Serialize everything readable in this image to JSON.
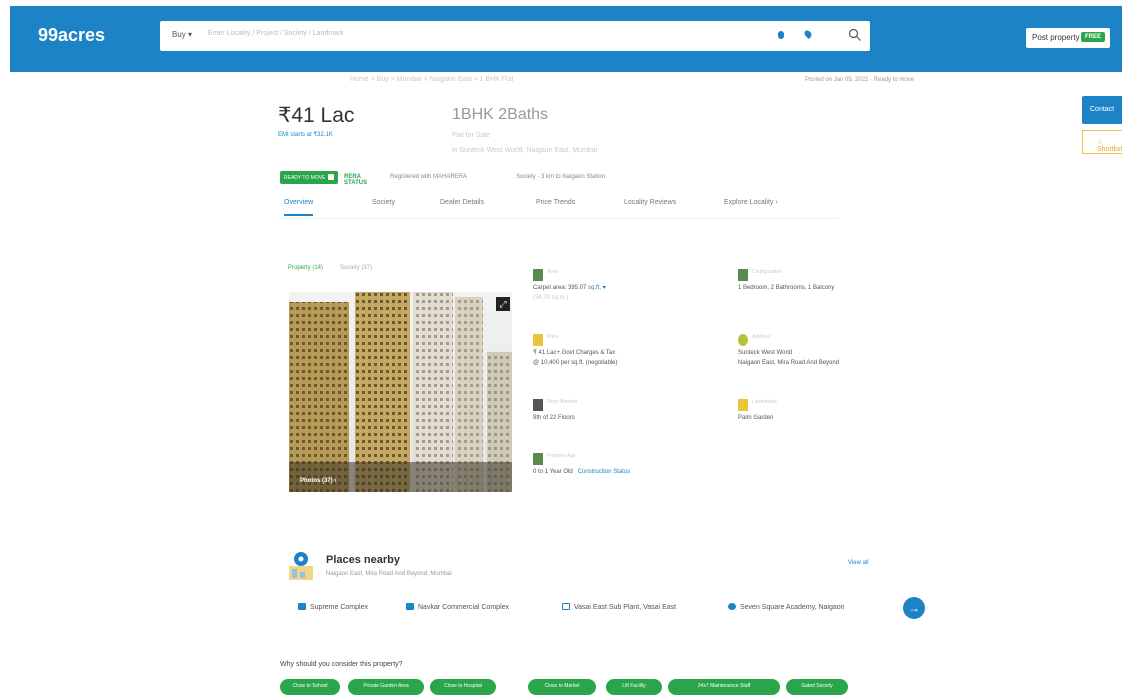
{
  "header": {
    "logo": "99acres",
    "search": {
      "buy_label": "Buy",
      "placeholder": "Enter Locality / Project / Society / Landmark"
    },
    "post_property": {
      "label": "Post property",
      "badge": "FREE"
    }
  },
  "breadcrumbs": "Home > Buy > Mumbai > Naigaon East > 1 BHK Flat",
  "posted": "Posted on Jan 05, 2022 · Ready to move",
  "listing": {
    "price": "₹41 Lac",
    "emi": "EMI starts at ₹32.1K",
    "config": "1BHK 2Baths",
    "subtitle": "Flat for Sale",
    "address": "in Sunteck West World, Naigaon East, Mumbai"
  },
  "actions": {
    "contact": "Contact",
    "shortlist": "☆ Shortlist"
  },
  "badges": {
    "status": "READY TO MOVE",
    "rera": "RERA STATUS",
    "approved": "Registered with MAHARERA",
    "society": "Society · 3 km to Naigaon Station"
  },
  "tabs": [
    "Overview",
    "Society",
    "Dealer Details",
    "Price Trends",
    "Locality Reviews",
    "Explore Locality"
  ],
  "photo_tabs": [
    "Property (14)",
    "Society (37)"
  ],
  "photo": {
    "count_label": "Photos (37) ›"
  },
  "facts": [
    {
      "icon": "area-icon",
      "label": "Area",
      "value": "Carpet area: 395.07",
      "link": "sq.ft.",
      "extra": "(36.70 sq.m.)"
    },
    {
      "icon": "config-icon",
      "label": "Configuration",
      "value": "1 Bedroom, 2 Bathrooms, 1 Balcony"
    },
    {
      "icon": "price-icon",
      "label": "Price",
      "value": "₹ 41 Lac+ Govt Charges & Tax",
      "extra": "@ 10,400 per sq.ft. (negotiable)"
    },
    {
      "icon": "address-icon",
      "label": "Address",
      "value": "Sunteck West World",
      "extra": "Naigaon East, Mira Road And Beyond"
    },
    {
      "icon": "floor-icon",
      "label": "Floor Number",
      "value": "9th of 22 Floors"
    },
    {
      "icon": "landmark-icon",
      "label": "Landmarks",
      "value": "Palm Garden"
    },
    {
      "icon": "age-icon",
      "label": "Property Age",
      "value": "0 to 1 Year Old",
      "link": "Construction Status"
    }
  ],
  "nearby": {
    "title": "Places nearby",
    "subtitle": "Naigaon East, Mira Road And Beyond, Mumbai",
    "view_all": "View all",
    "places": [
      "Supreme Complex",
      "Navkar Commercial Complex",
      "Vasai East Sub Plant, Vasai East",
      "Seven Square Academy, Naigaon"
    ]
  },
  "why": {
    "question": "Why should you consider this property?",
    "tags": [
      "Close to School",
      "Private Garden Area",
      "Close to Hospital",
      "Close to Market",
      "Lift Facility",
      "24x7 Maintenance Staff",
      "Gated Society"
    ]
  },
  "colors": {
    "brand_blue": "#1c84c6",
    "green": "#2aa54b",
    "yellow": "#f1c14b"
  }
}
